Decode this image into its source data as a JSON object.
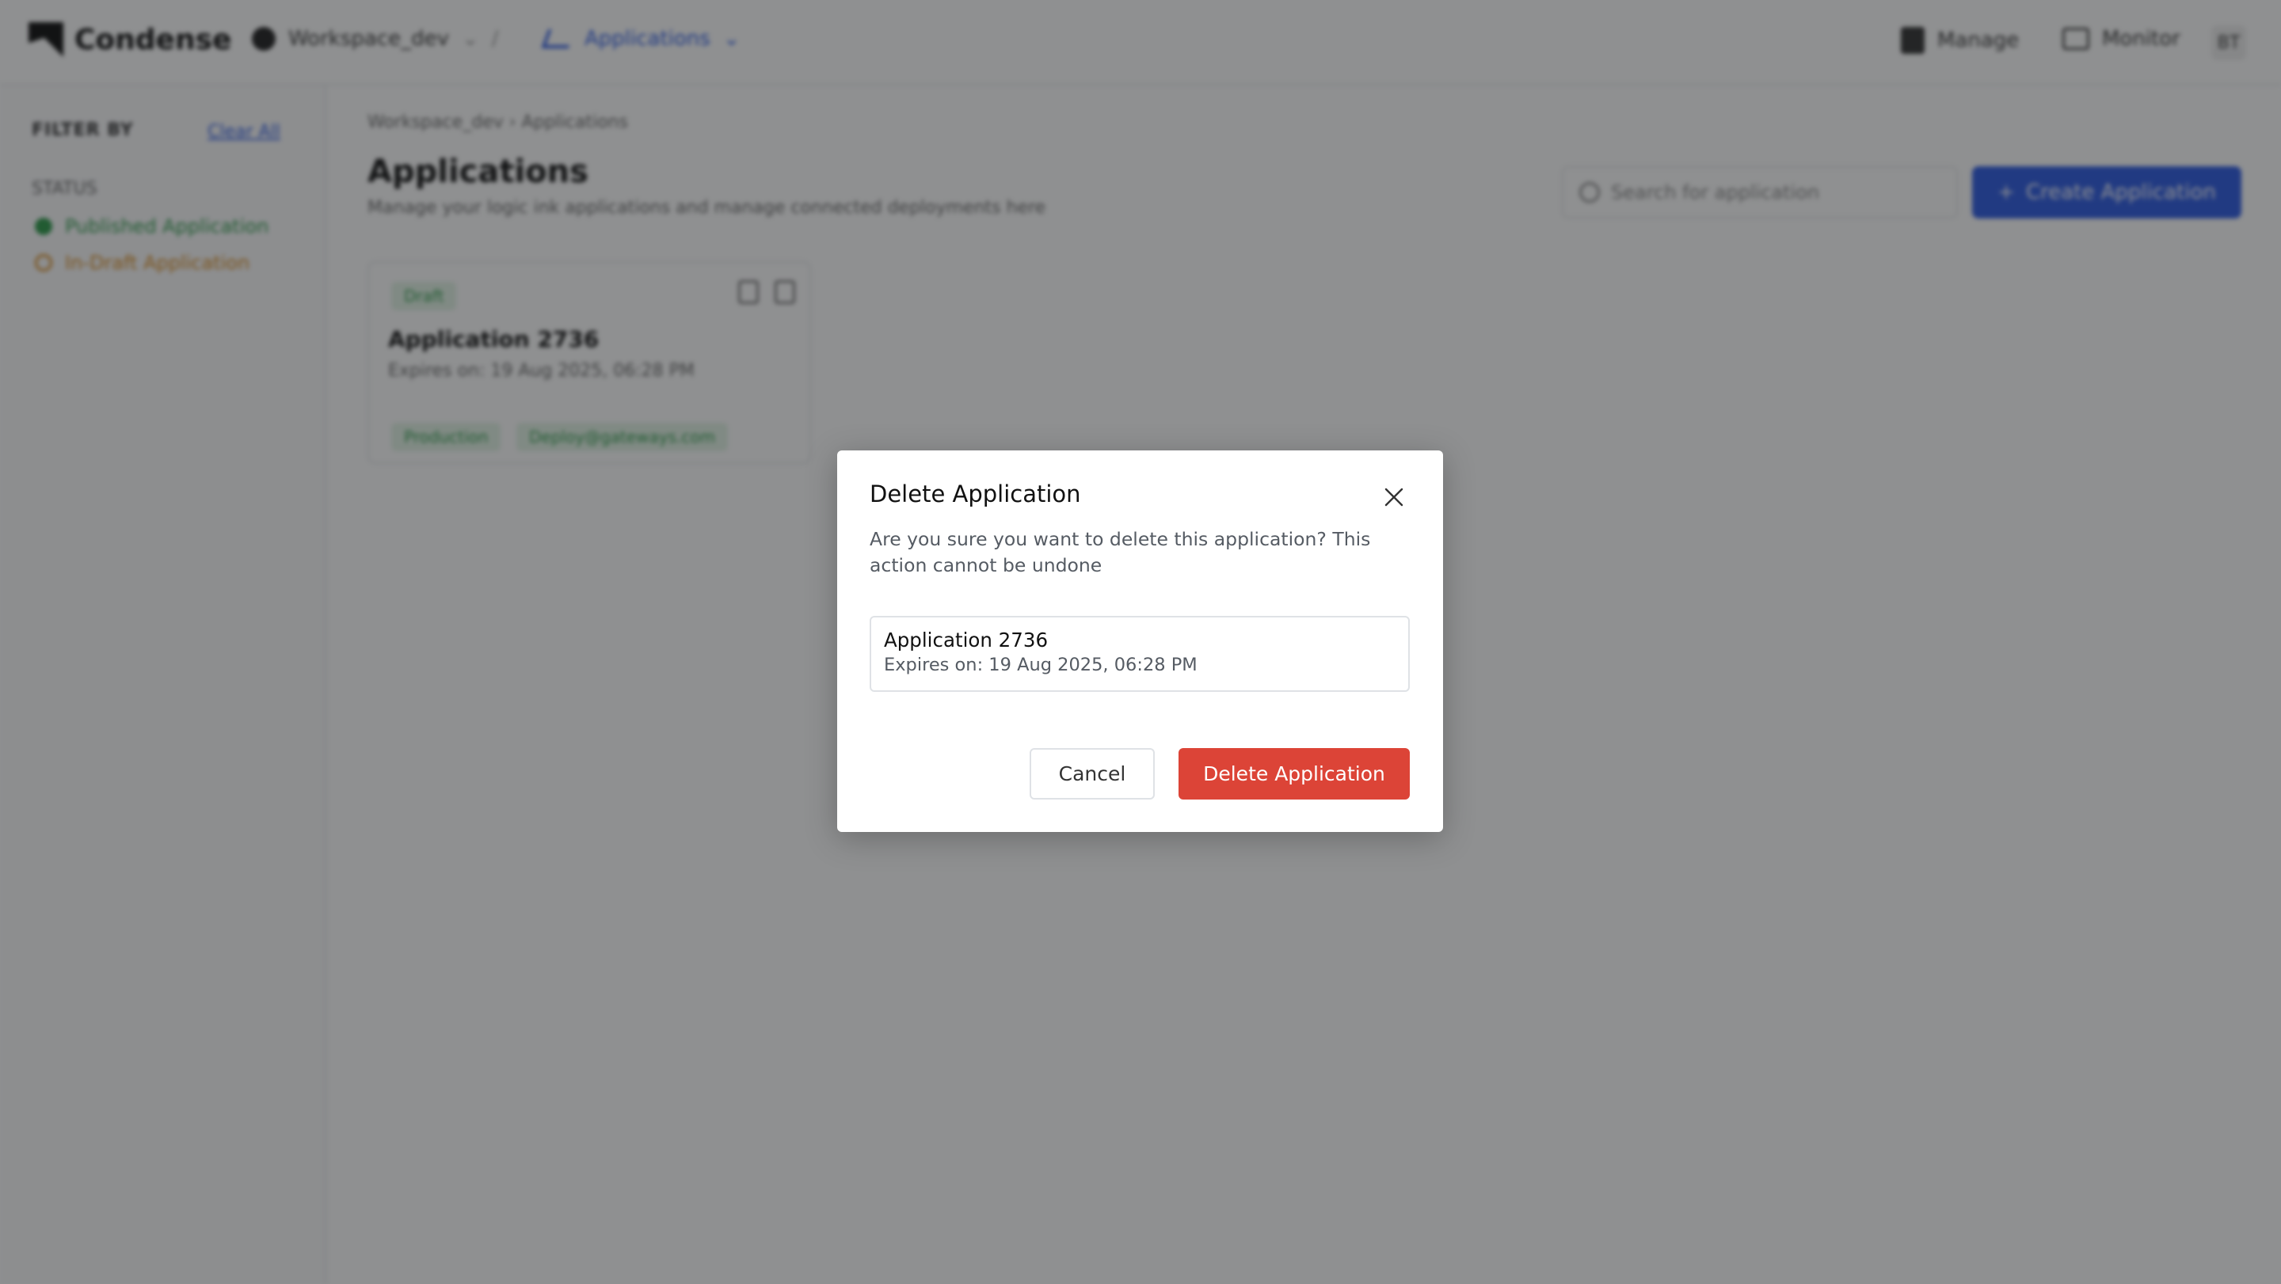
{
  "app": {
    "brand": "Condense",
    "workspace": "Workspace_dev",
    "section": "Applications",
    "manage_label": "Manage",
    "monitor_label": "Monitor",
    "avatar_initials": "BT"
  },
  "sidebar": {
    "heading": "FILTER BY",
    "clear_link": "Clear All",
    "group_label": "STATUS",
    "items": [
      {
        "label": "Published Application",
        "color": "#2e9a4a"
      },
      {
        "label": "In-Draft Application",
        "color": "#d68a1e"
      }
    ]
  },
  "main": {
    "breadcrumb": "Workspace_dev  ›  Applications",
    "title": "Applications",
    "subtitle": "Manage your logic ink applications and manage connected deployments here",
    "search_placeholder": "Search for application",
    "create_button": "Create Application",
    "card": {
      "badge": "Draft",
      "title": "Application 2736",
      "subtitle": "Expires on: 19 Aug 2025, 06:28 PM",
      "tags": [
        "Production",
        "Deploy@gateways.com"
      ]
    }
  },
  "modal": {
    "title": "Delete Application",
    "description": "Are you sure you want to delete this application? This action cannot be undone",
    "app_name": "Application 2736",
    "app_expiry": "Expires on: 19 Aug 2025, 06:28 PM",
    "cancel_label": "Cancel",
    "delete_label": "Delete Application",
    "delete_color": "#dc4437",
    "close_icon": "close-icon"
  }
}
